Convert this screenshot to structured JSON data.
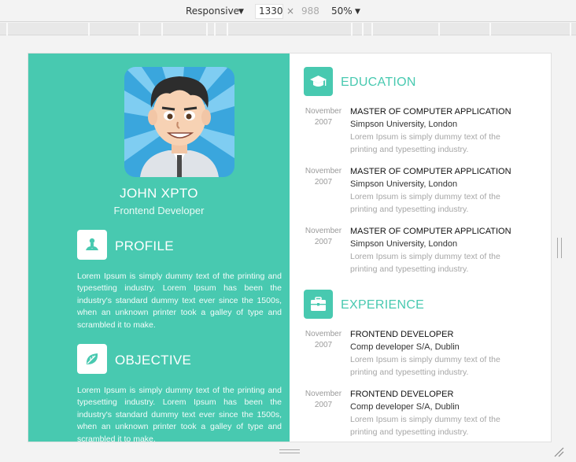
{
  "devtools": {
    "device": "Responsive",
    "width": "1330",
    "times": "×",
    "height": "988",
    "zoom": "50%"
  },
  "resume": {
    "name": "JOHN XPTO",
    "role": "Frontend Developer",
    "profile": {
      "title": "PROFILE",
      "text": "Lorem Ipsum is simply dummy text of the printing and typesetting industry. Lorem Ipsum has been the industry's standard dummy text ever since the 1500s, when an unknown printer took a galley of type and scrambled it to make."
    },
    "objective": {
      "title": "OBJECTIVE",
      "text": "Lorem Ipsum is simply dummy text of the printing and typesetting industry. Lorem Ipsum has been the industry's standard dummy text ever since the 1500s, when an unknown printer took a galley of type and scrambled it to make."
    },
    "education": {
      "title": "EDUCATION",
      "entries": [
        {
          "month": "November",
          "year": "2007",
          "title": "MASTER OF COMPUTER APPLICATION",
          "subtitle": "Simpson University, London",
          "desc": "Lorem Ipsum is simply dummy text of the printing and typesetting industry."
        },
        {
          "month": "November",
          "year": "2007",
          "title": "MASTER OF COMPUTER APPLICATION",
          "subtitle": "Simpson University, London",
          "desc": "Lorem Ipsum is simply dummy text of the printing and typesetting industry."
        },
        {
          "month": "November",
          "year": "2007",
          "title": "MASTER OF COMPUTER APPLICATION",
          "subtitle": "Simpson University, London",
          "desc": "Lorem Ipsum is simply dummy text of the printing and typesetting industry."
        }
      ]
    },
    "experience": {
      "title": "EXPERIENCE",
      "entries": [
        {
          "month": "November",
          "year": "2007",
          "title": "FRONTEND DEVELOPER",
          "subtitle": "Comp developer S/A, Dublin",
          "desc": "Lorem Ipsum is simply dummy text of the printing and typesetting industry."
        },
        {
          "month": "November",
          "year": "2007",
          "title": "FRONTEND DEVELOPER",
          "subtitle": "Comp developer S/A, Dublin",
          "desc": "Lorem Ipsum is simply dummy text of the printing and typesetting industry."
        }
      ]
    }
  },
  "colors": {
    "accent": "#48c9b0",
    "panel": "#ffffff",
    "toolbar": "#f3f3f3"
  },
  "icons": {
    "profile": "person-icon",
    "objective": "leaf-icon",
    "education": "graduation-cap-icon",
    "experience": "briefcase-icon"
  }
}
